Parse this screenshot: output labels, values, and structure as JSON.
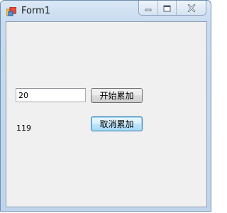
{
  "window": {
    "title": "Form1"
  },
  "title_controls": {
    "minimize_icon": "minimize-icon",
    "maximize_icon": "maximize-icon",
    "close_icon": "close-icon"
  },
  "form": {
    "input_value": "20",
    "start_button_label": "开始累加",
    "cancel_button_label": "取消累加",
    "result_label": "119"
  },
  "colors": {
    "client_background": "#f0f0f0",
    "focused_button_border": "#3c7fb1"
  }
}
